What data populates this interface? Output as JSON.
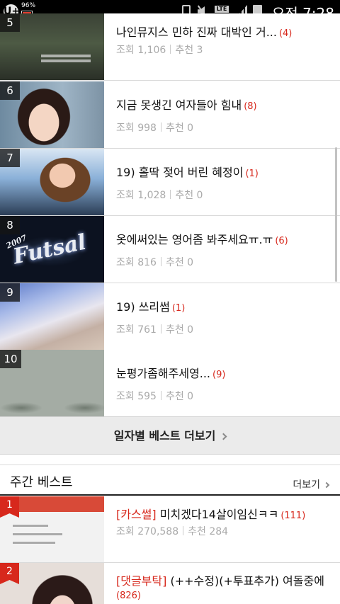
{
  "status_bar": {
    "carrier_icon": "U+",
    "battery_small_pct": "96%",
    "icons": [
      "phone-vibrate-icon",
      "mute-icon",
      "lte-icon",
      "signal-icon",
      "battery-icon"
    ],
    "lte_label": "LTE",
    "time": "오전 7:28"
  },
  "daily_best": {
    "items": [
      {
        "rank": "5",
        "title": "나인뮤지스 민하 진짜 대박인 거...",
        "count": "(4)",
        "views_label": "조회",
        "views": "1,106",
        "likes_label": "추천",
        "likes": "3"
      },
      {
        "rank": "6",
        "title": "지금 못생긴 여자들아 힘내",
        "count": "(8)",
        "views_label": "조회",
        "views": "998",
        "likes_label": "추천",
        "likes": "0"
      },
      {
        "rank": "7",
        "title": "19) 홀딱 젖어 버린 혜정이",
        "count": "(1)",
        "views_label": "조회",
        "views": "1,028",
        "likes_label": "추천",
        "likes": "0"
      },
      {
        "rank": "8",
        "title": "옷에써있는 영어좀 봐주세요ㅠ.ㅠ",
        "count": "(6)",
        "views_label": "조회",
        "views": "816",
        "likes_label": "추천",
        "likes": "0"
      },
      {
        "rank": "9",
        "title": "19) 쓰리썸",
        "count": "(1)",
        "views_label": "조회",
        "views": "761",
        "likes_label": "추천",
        "likes": "0"
      },
      {
        "rank": "10",
        "title": "눈평가좀해주세영...",
        "count": "(9)",
        "views_label": "조회",
        "views": "595",
        "likes_label": "추천",
        "likes": "0"
      }
    ],
    "thumb_text": {
      "year": "2007",
      "futsal": "Futsal"
    },
    "more_button": "일자별 베스트 더보기"
  },
  "weekly_best": {
    "title": "주간 베스트",
    "more_link": "더보기",
    "items": [
      {
        "rank": "1",
        "tag": "[카스썰]",
        "title": "미치겠다14살이임신ㅋㅋ",
        "count": "(111)",
        "views_label": "조회",
        "views": "270,588",
        "likes_label": "추천",
        "likes": "284"
      },
      {
        "rank": "2",
        "tag": "[댓글부탁]",
        "title": "(++수정)(+투표추가) 여돌중에",
        "count": "(826)"
      }
    ]
  },
  "colors": {
    "accent_red": "#d7281c",
    "meta_gray": "#aaaaaa",
    "button_bg": "#ebebeb"
  }
}
